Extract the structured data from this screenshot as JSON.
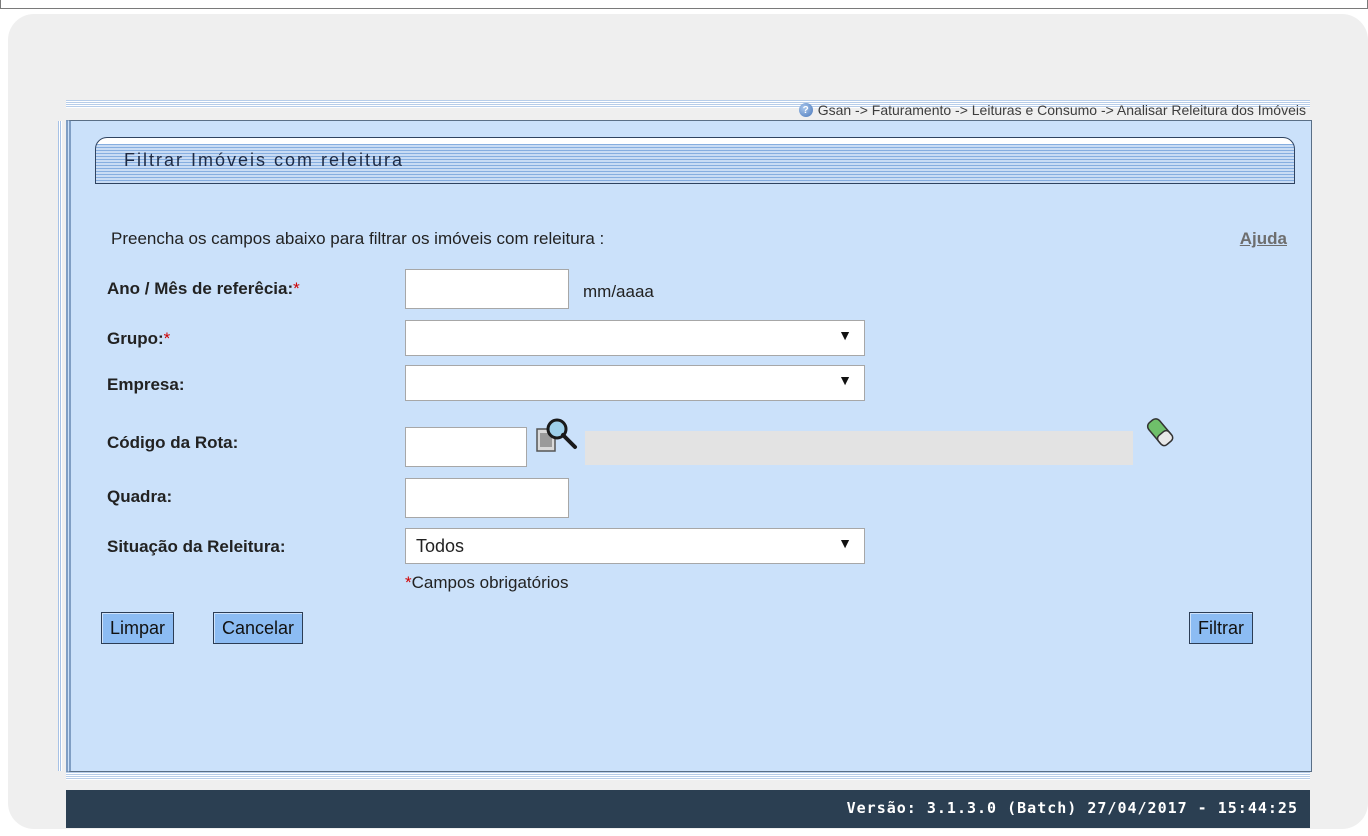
{
  "breadcrumb": "Gsan -> Faturamento -> Leituras e Consumo -> Analisar Releitura dos Imóveis",
  "form_title": "Filtrar Imóveis com releitura",
  "intro_text": "Preencha os campos abaixo para filtrar os imóveis com releitura :",
  "help_link": "Ajuda",
  "fields": {
    "ano_mes": {
      "label": "Ano / Mês de referêcia:",
      "required": "*",
      "value": "",
      "hint": "mm/aaaa"
    },
    "grupo": {
      "label": "Grupo:",
      "required": "*",
      "value": ""
    },
    "empresa": {
      "label": "Empresa:",
      "value": ""
    },
    "codigo_rota": {
      "label": "Código da Rota:",
      "value": "",
      "description": ""
    },
    "quadra": {
      "label": "Quadra:",
      "value": ""
    },
    "situacao": {
      "label": "Situação da Releitura:",
      "value": "Todos"
    }
  },
  "mandatory_note": {
    "asterisk": "*",
    "text": "Campos obrigatórios"
  },
  "buttons": {
    "limpar": "Limpar",
    "cancelar": "Cancelar",
    "filtrar": "Filtrar"
  },
  "footer_version": "Versão: 3.1.3.0 (Batch) 27/04/2017 - 15:44:25",
  "icons": {
    "help": "help-icon",
    "lookup": "magnifier-search-icon",
    "clear": "eraser-icon",
    "dropdown": "triangle-down-icon"
  },
  "colors": {
    "panel_bg": "#cbe1fa",
    "button_bg": "#8cbcf3",
    "footer_bg": "#2b3f52",
    "required": "#d00000"
  }
}
